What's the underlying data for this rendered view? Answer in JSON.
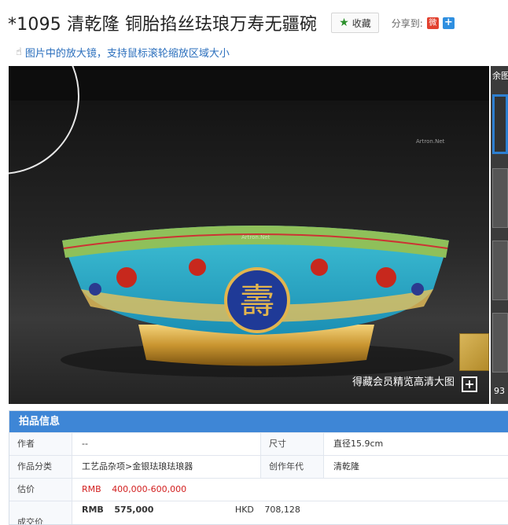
{
  "header": {
    "title": "*1095 清乾隆 铜胎掐丝珐琅万寿无疆碗",
    "favorite_label": "收藏",
    "share_label": "分享到:",
    "share_weibo_icon": "weibo-icon",
    "share_more_icon": "plus-icon"
  },
  "tip": {
    "text": "图片中的放大镜，支持鼠标滚轮缩放区域大小"
  },
  "viewer": {
    "watermark": "Artron.Net",
    "hd_label": "得藏会员精览高清大图"
  },
  "thumbnails": {
    "heading": "余图",
    "count": "93"
  },
  "info": {
    "heading": "拍品信息",
    "author_label": "作者",
    "author_value": "--",
    "size_label": "尺寸",
    "size_value": "直径15.9cm",
    "category_label": "作品分类",
    "category_value": "工艺品杂项>金银珐琅珐琅器",
    "era_label": "创作年代",
    "era_value": "清乾隆",
    "estimate_label": "估价",
    "estimate_currency": "RMB",
    "estimate_value": "400,000-600,000",
    "deal_label": "成交价",
    "deal_currency": "RMB",
    "deal_value": "575,000",
    "deal_currency2": "HKD",
    "deal_value2": "708,128"
  }
}
